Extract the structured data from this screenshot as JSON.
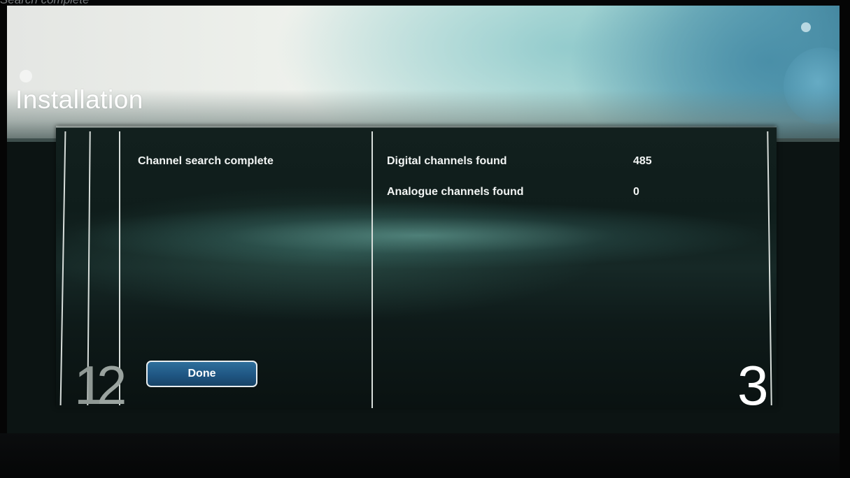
{
  "caption": "Search complete",
  "title": "Installation",
  "steps": {
    "first": "1",
    "second": "2",
    "third": "3"
  },
  "status": "Channel search complete",
  "results": [
    {
      "label": "Digital channels found",
      "value": "485"
    },
    {
      "label": "Analogue channels found",
      "value": "0"
    }
  ],
  "done_label": "Done",
  "colors": {
    "panel_bg": "#0f1d1b",
    "button_bg": "#1f5683",
    "button_border": "#e8eef0",
    "text": "#f2f5f4"
  }
}
